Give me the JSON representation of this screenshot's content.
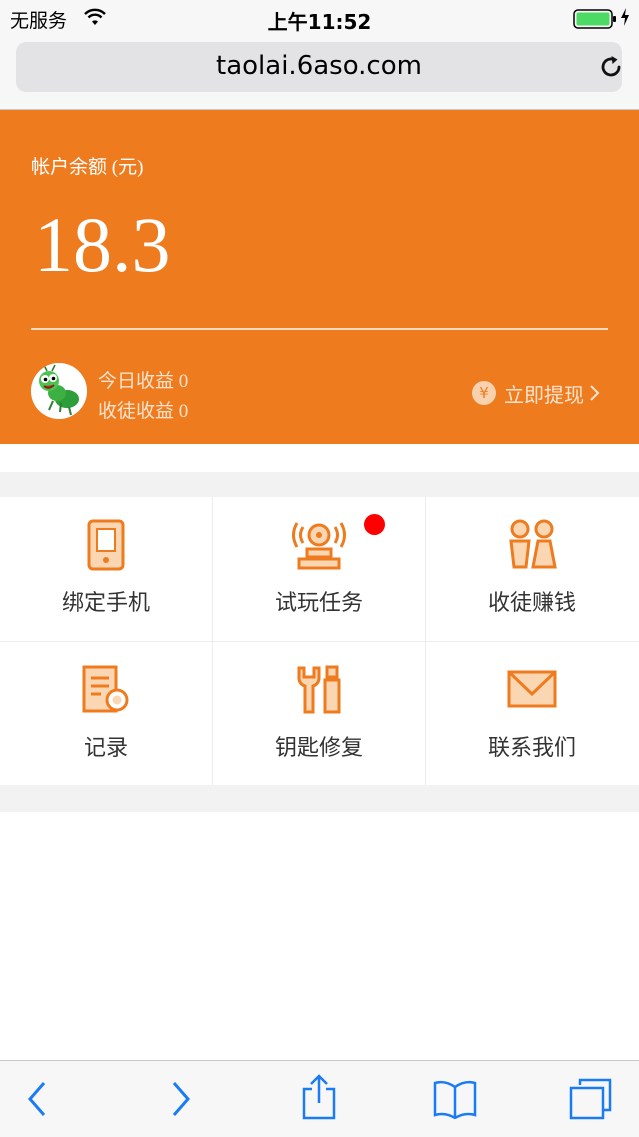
{
  "status_bar": {
    "carrier": "无服务",
    "time": "上午11:52"
  },
  "browser": {
    "url": "taolai.6aso.com"
  },
  "account": {
    "balance_label": "帐户余额 (元)",
    "balance_value": "18.3",
    "today_income": "今日收益 0",
    "disciple_income": "收徒收益 0",
    "withdraw_label": "立即提现",
    "withdraw_icon_text": "¥"
  },
  "menu": {
    "items": [
      {
        "label": "绑定手机",
        "icon": "phone-icon"
      },
      {
        "label": "试玩任务",
        "icon": "task-bell-icon",
        "badge": true
      },
      {
        "label": "收徒赚钱",
        "icon": "people-icon"
      },
      {
        "label": "记录",
        "icon": "record-icon"
      },
      {
        "label": "钥匙修复",
        "icon": "tools-icon"
      },
      {
        "label": "联系我们",
        "icon": "mail-icon"
      }
    ]
  },
  "colors": {
    "accent": "#ef7b1f",
    "badge": "#ff0000",
    "ios_blue": "#1a7cf5"
  }
}
